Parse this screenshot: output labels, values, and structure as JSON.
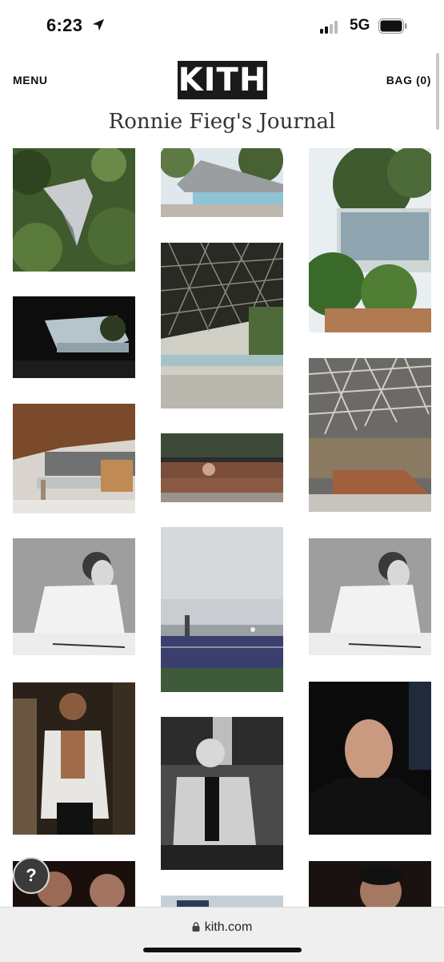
{
  "status_bar": {
    "time": "6:23",
    "network": "5G"
  },
  "header": {
    "menu_label": "MENU",
    "logo_text": "KITH",
    "bag_label": "BAG  (0)"
  },
  "journal": {
    "title": "Ronnie Fieg's Journal"
  },
  "gallery": {
    "photos": [
      "aerial-view-house-in-forest",
      "angular-roof-house-with-pool",
      "glass-house-overlooking-city",
      "view-from-under-roof-to-sea",
      "triangular-coffered-roof-over-pool",
      "living-room-under-wood-roof",
      "concrete-coffered-ceiling-interior",
      "architect-at-drafting-table",
      "sunken-lounge-interior",
      "tennis-court-in-fog",
      "architect-at-drafting-table",
      "actor-in-walk-in-closet",
      "actor-in-courtroom",
      "actor-portrait-black-jacket",
      "two-men-portrait",
      "partial-image",
      "actor-portrait-partial"
    ]
  },
  "browser": {
    "url": "kith.com"
  },
  "icons": {
    "location": "location-arrow-icon",
    "help": "question-mark-icon",
    "lock": "lock-icon"
  }
}
